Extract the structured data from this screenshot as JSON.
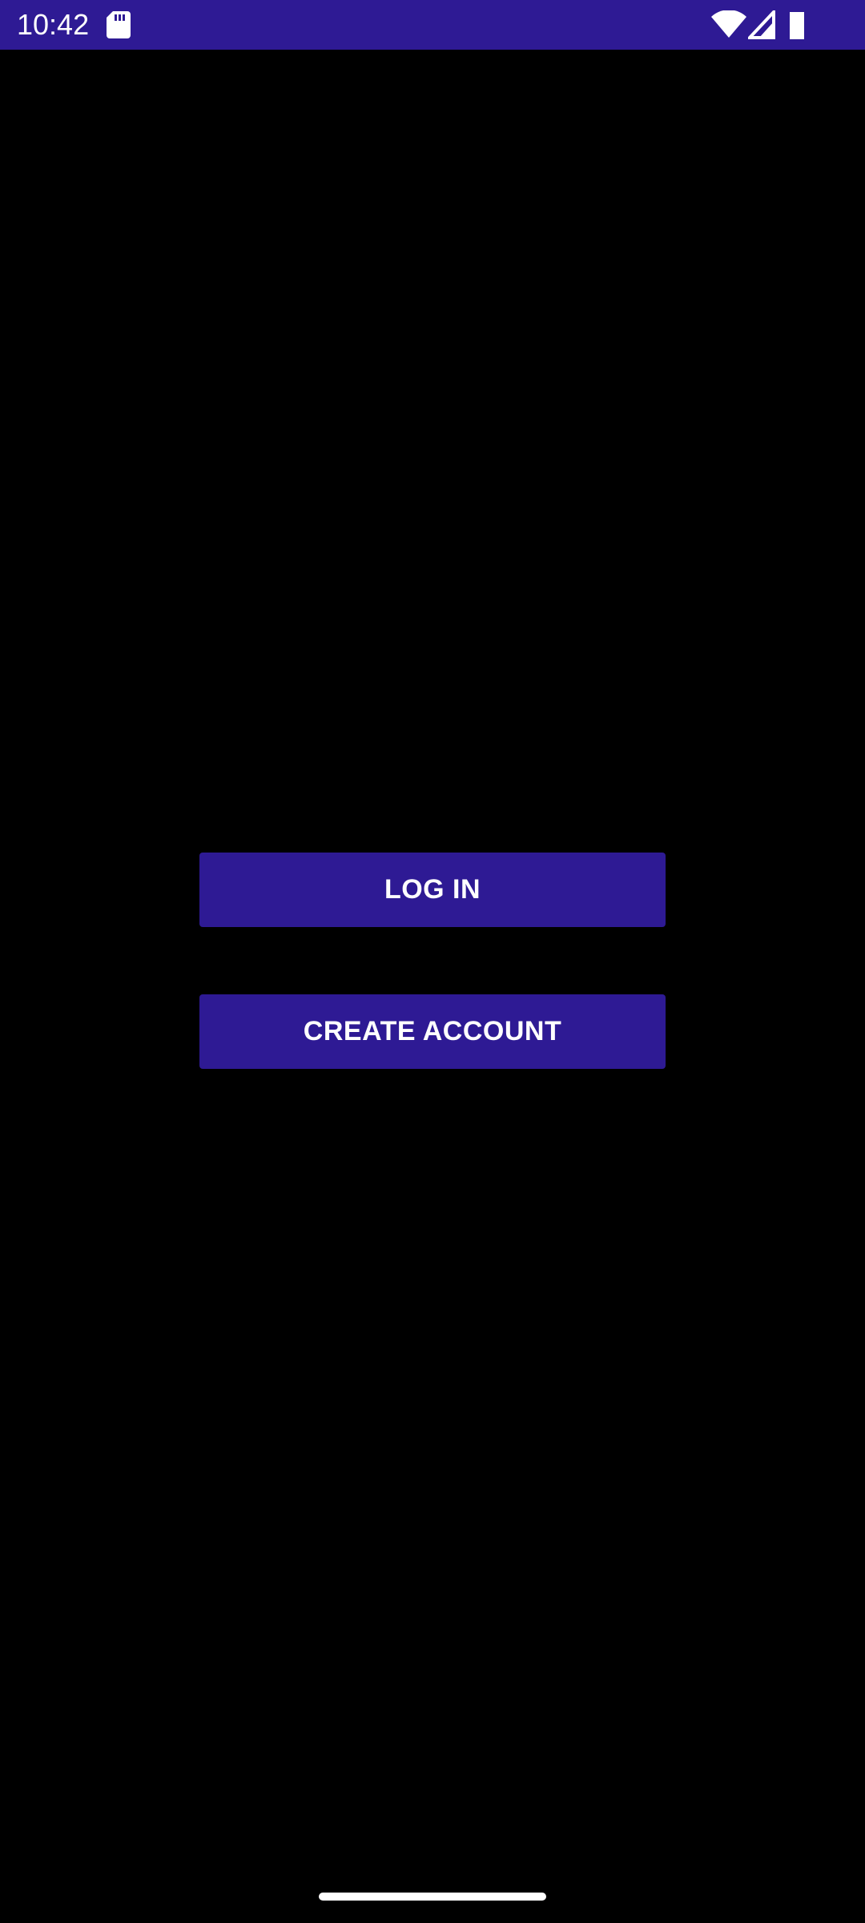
{
  "status_bar": {
    "time": "10:42",
    "background_color": "#2e1a94",
    "icons": [
      "sd-card-icon",
      "wifi-icon",
      "cell-signal-icon",
      "battery-icon"
    ]
  },
  "actions": {
    "login_label": "LOG IN",
    "create_account_label": "CREATE ACCOUNT",
    "button_color": "#2e1a94",
    "text_color": "#ffffff"
  },
  "screen": {
    "background_color": "#000000"
  }
}
